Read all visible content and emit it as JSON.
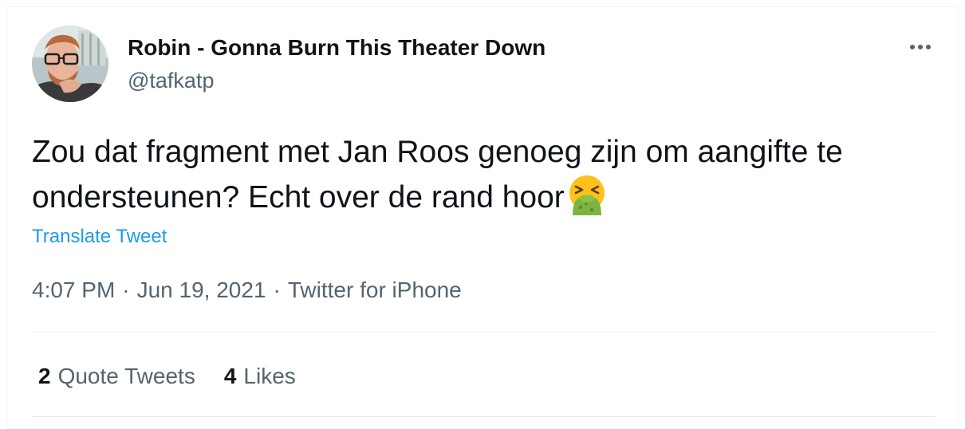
{
  "user": {
    "display_name": "Robin - Gonna Burn This Theater Down",
    "handle": "@tafkatp",
    "avatar": "profile-photo-avatar"
  },
  "tweet": {
    "text": "Zou dat fragment met Jan Roos genoeg zijn om aangifte te ondersteunen? Echt over de rand hoor",
    "emoji": "face-vomiting-icon",
    "translate_label": "Translate Tweet",
    "time": "4:07 PM",
    "date": "Jun 19, 2021",
    "source": "Twitter for iPhone",
    "separator": "·"
  },
  "stats": {
    "quote_count": "2",
    "quote_label": "Quote Tweets",
    "like_count": "4",
    "like_label": "Likes"
  },
  "icons": {
    "more": "more-horizontal-icon"
  },
  "colors": {
    "link": "#1d9bf0",
    "secondary_text": "#536471",
    "primary_text": "#0f1419",
    "divider": "#e6e9eb"
  }
}
